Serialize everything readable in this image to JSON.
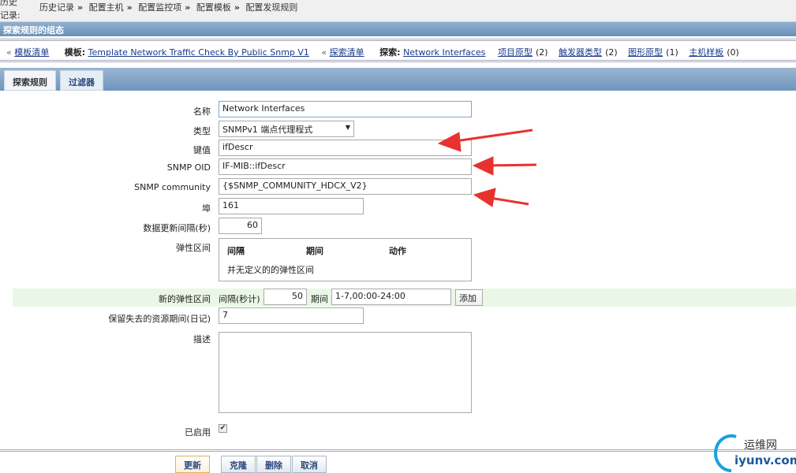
{
  "breadcrumb": {
    "label": "历史记录:",
    "items": [
      "历史记录",
      "配置主机",
      "配置监控项",
      "配置模板",
      "配置发现规则"
    ],
    "separator": "»"
  },
  "header": {
    "title": "探索规则的组态"
  },
  "nav": {
    "template_list": "模板清单",
    "template_label": "模板:",
    "template_name": "Template Network Traffic Check By Public Snmp V1",
    "discovery_list": "探索清单",
    "discovery_label": "探索:",
    "discovery_name": "Network Interfaces",
    "links": [
      {
        "label": "项目原型",
        "count": "(2)"
      },
      {
        "label": "触发器类型",
        "count": "(2)"
      },
      {
        "label": "图形原型",
        "count": "(1)"
      },
      {
        "label": "主机样板",
        "count": "(0)"
      }
    ]
  },
  "tabs": [
    "探索规则",
    "过滤器"
  ],
  "form": {
    "name": {
      "label": "名称",
      "value": "Network Interfaces"
    },
    "type": {
      "label": "类型",
      "value": "SNMPv1 端点代理程式"
    },
    "key": {
      "label": "键值",
      "value": "ifDescr"
    },
    "oid": {
      "label": "SNMP OID",
      "value": "IF-MIB::ifDescr"
    },
    "community": {
      "label": "SNMP community",
      "value": "{$SNMP_COMMUNITY_HDCX_V2}"
    },
    "port": {
      "label": "埠",
      "value": "161"
    },
    "interval": {
      "label": "数据更新间隔(秒)",
      "value": "60"
    },
    "flex": {
      "label": "弹性区间",
      "columns": [
        "间隔",
        "期间",
        "动作"
      ],
      "empty": "并无定义的的弹性区间"
    },
    "new_flex": {
      "label": "新的弹性区间",
      "interval_label": "间隔(秒计)",
      "interval_value": "50",
      "period_label": "期间",
      "period_value": "1-7,00:00-24:00",
      "add": "添加"
    },
    "lifetime": {
      "label": "保留失去的资源期间(日记)",
      "value": "7"
    },
    "description": {
      "label": "描述",
      "value": ""
    },
    "enabled": {
      "label": "已启用",
      "checked": true
    }
  },
  "buttons": {
    "update": "更新",
    "clone": "克隆",
    "delete": "删除",
    "cancel": "取消"
  },
  "watermark": {
    "cn": "运维网",
    "url": "iyunv.com"
  },
  "colors": {
    "header": "#6a90b8",
    "annotation_arrow": "#e8322f",
    "link": "#1a3a8a"
  }
}
